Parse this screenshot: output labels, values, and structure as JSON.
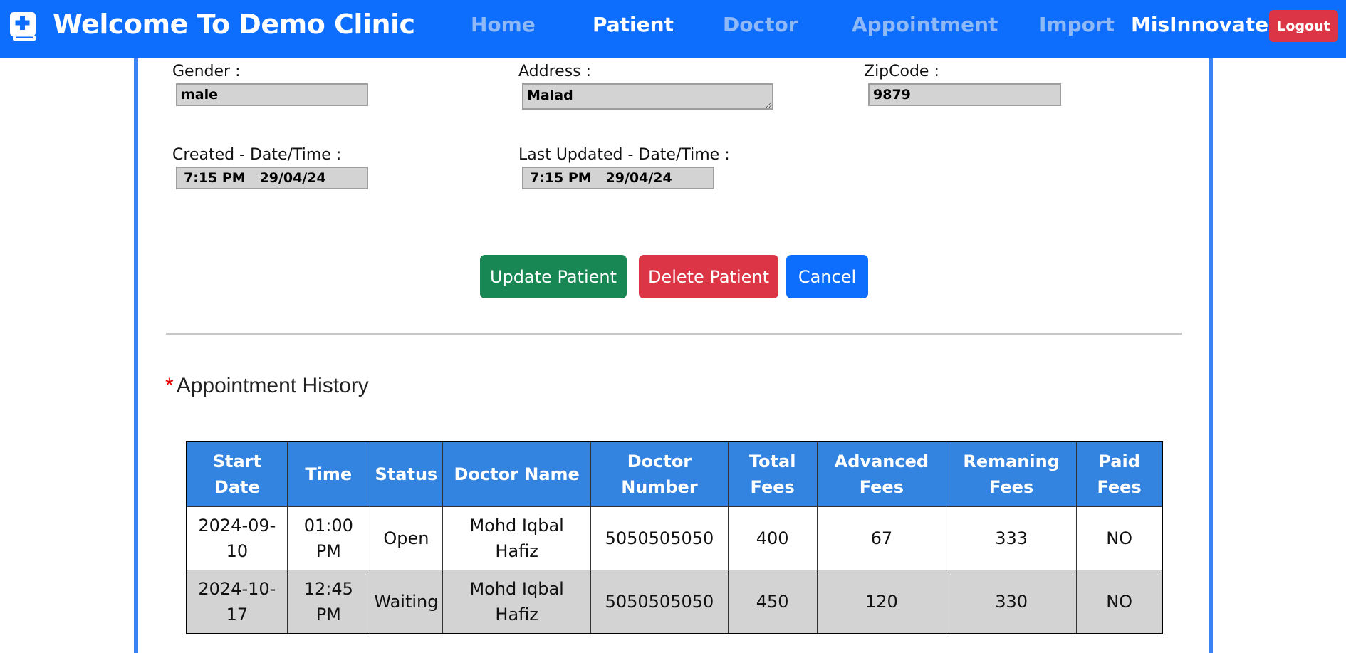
{
  "navbar": {
    "brand_title": "Welcome To Demo Clinic",
    "brand_icon": "clinic-book-plus-icon",
    "links": [
      {
        "label": "Home",
        "active": false
      },
      {
        "label": "Patient",
        "active": true
      },
      {
        "label": "Doctor",
        "active": false
      },
      {
        "label": "Appointment",
        "active": false
      },
      {
        "label": "Import",
        "active": false
      }
    ],
    "user_name": "MisInnovate",
    "logout_label": "Logout"
  },
  "form": {
    "gender": {
      "label": "Gender :",
      "value": "male"
    },
    "address": {
      "label": "Address :",
      "value": "Malad"
    },
    "zipcode": {
      "label": "ZipCode :",
      "value": "9879"
    },
    "created": {
      "label": "Created - Date/Time :",
      "value": "7:15 PM   29/04/24"
    },
    "updated": {
      "label": "Last Updated - Date/Time :",
      "value": "7:15 PM   29/04/24"
    }
  },
  "actions": {
    "update_label": "Update Patient",
    "delete_label": "Delete Patient",
    "cancel_label": "Cancel"
  },
  "history": {
    "required_marker": "*",
    "title": "Appointment History",
    "columns": [
      "Start Date",
      "Time",
      "Status",
      "Doctor Name",
      "Doctor Number",
      "Total Fees",
      "Advanced Fees",
      "Remaning Fees",
      "Paid Fees"
    ],
    "rows": [
      [
        "2024-09-10",
        "01:00 PM",
        "Open",
        "Mohd Iqbal Hafiz",
        "5050505050",
        "400",
        "67",
        "333",
        "NO"
      ],
      [
        "2024-10-17",
        "12:45 PM",
        "Waiting",
        "Mohd Iqbal Hafiz",
        "5050505050",
        "450",
        "120",
        "330",
        "NO"
      ]
    ]
  },
  "colors": {
    "navbar": "#0d6efd",
    "table_header": "#3383e0",
    "success": "#198754",
    "danger": "#dc3545",
    "primary": "#0d6efd"
  }
}
